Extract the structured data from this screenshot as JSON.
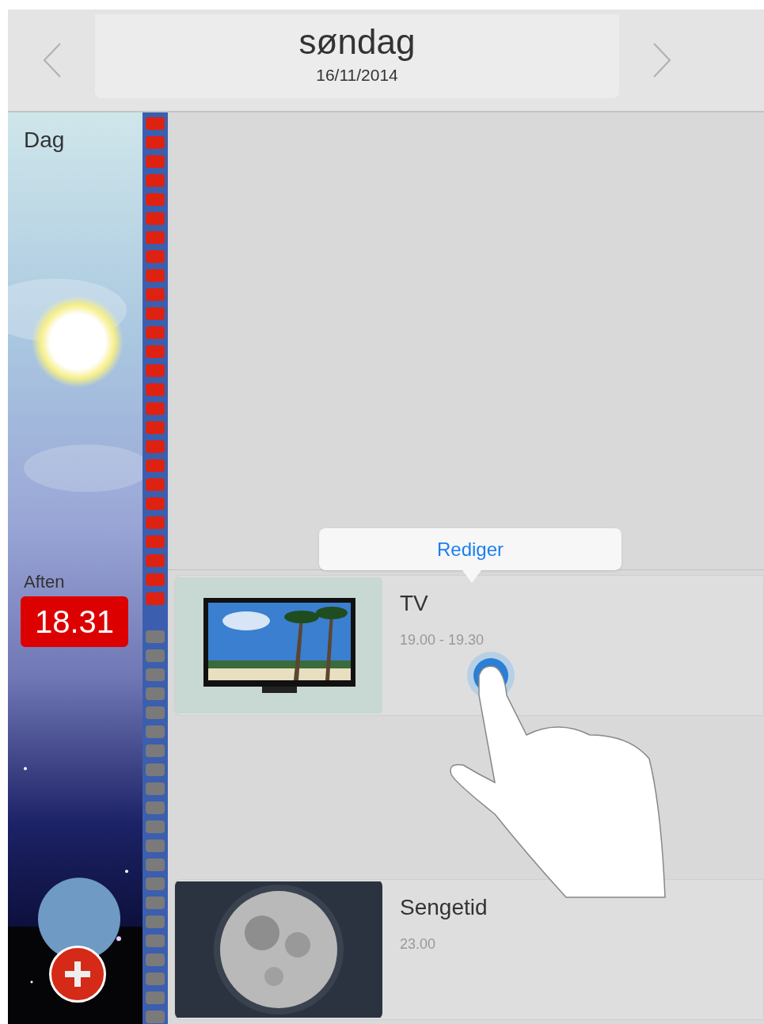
{
  "header": {
    "day": "søndag",
    "date": "16/11/2014"
  },
  "sky": {
    "sections": [
      "Dag",
      "Aften"
    ],
    "current_time": "18.31"
  },
  "timeline": {
    "level": 0.55
  },
  "popup": {
    "label": "Rediger"
  },
  "events": [
    {
      "title": "TV",
      "time": "19.00 - 19.30",
      "kind": "picture"
    },
    {
      "title": "Sengetid",
      "time": "23.00",
      "kind": "picture"
    }
  ]
}
